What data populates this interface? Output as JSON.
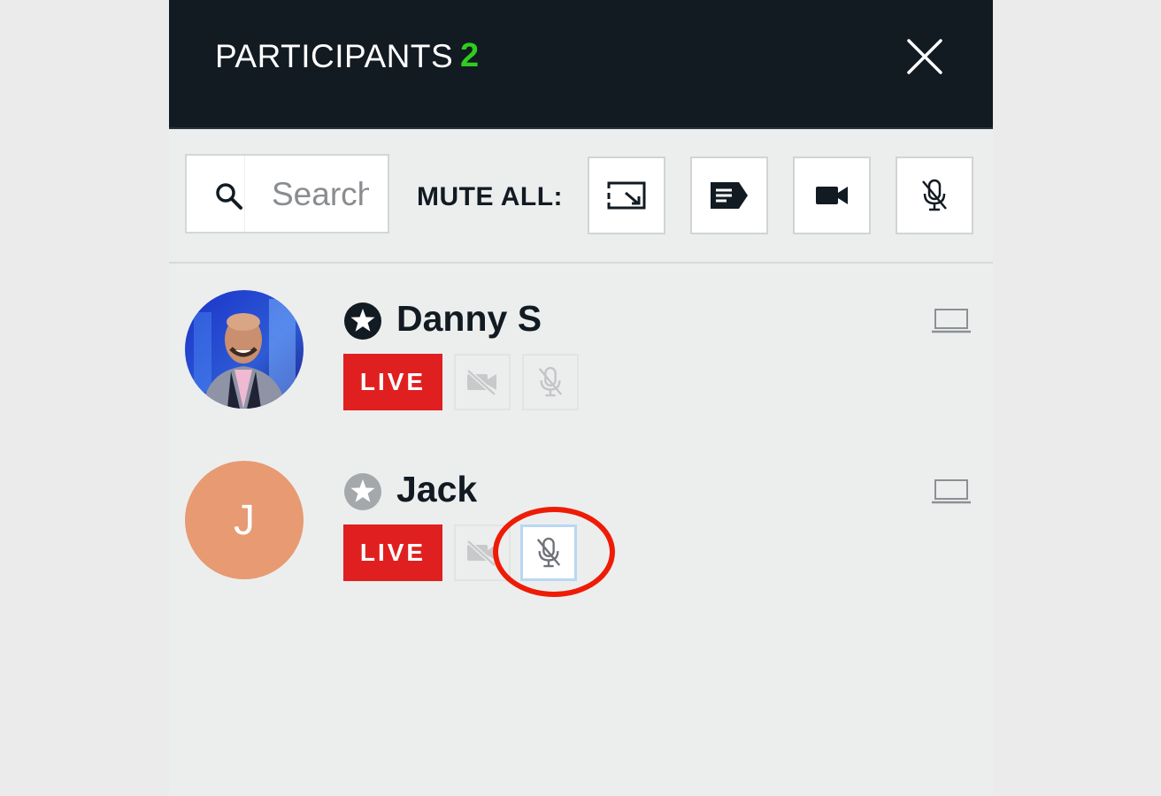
{
  "panel": {
    "title": "PARTICIPANTS",
    "count": "2",
    "close_icon": "close-icon"
  },
  "toolbar": {
    "search_placeholder": "Search",
    "mute_all_label": "MUTE ALL:",
    "buttons": [
      {
        "name": "screen-share-icon"
      },
      {
        "name": "chat-icon"
      },
      {
        "name": "video-camera-icon"
      },
      {
        "name": "mic-muted-icon"
      }
    ]
  },
  "participants": [
    {
      "name": "Danny S",
      "role_icon": "host-star-icon",
      "status": "LIVE",
      "video_icon": "video-off-icon",
      "mic_icon": "mic-muted-icon",
      "device_icon": "laptop-icon",
      "avatar": "photo"
    },
    {
      "name": "Jack",
      "initial": "J",
      "role_icon": "star-icon",
      "status": "LIVE",
      "video_icon": "video-off-icon",
      "mic_icon": "mic-muted-icon",
      "device_icon": "laptop-icon",
      "avatar": "initial"
    }
  ],
  "colors": {
    "header_bg": "#121a22",
    "count": "#2ecc1e",
    "live": "#e02020",
    "annotation": "#ee1c07",
    "avatar_jack": "#e89a72"
  }
}
